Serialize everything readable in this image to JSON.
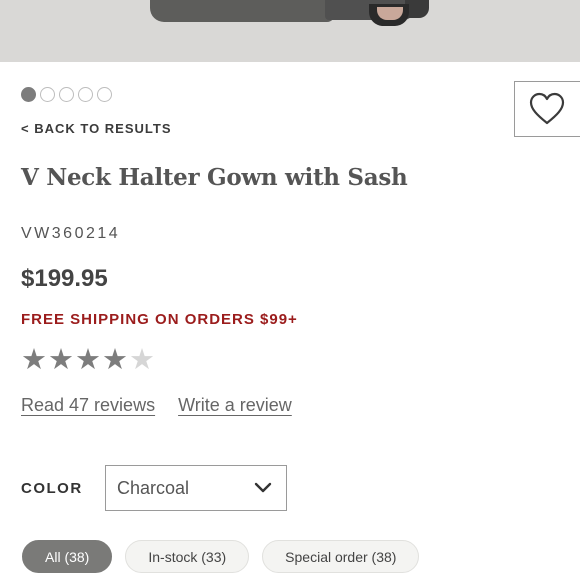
{
  "gallery": {
    "image": "product-photo-gown-bottom",
    "dot_count": 5,
    "active_dot": 0
  },
  "favorite": {
    "icon": "heart-icon"
  },
  "nav": {
    "back_label": "< BACK TO RESULTS"
  },
  "product": {
    "title": "V Neck Halter Gown with Sash",
    "sku": "VW360214",
    "price": "$199.95",
    "shipping_promo": "FREE SHIPPING ON ORDERS $99+",
    "rating": 4,
    "rating_max": 5
  },
  "reviews": {
    "read_label": "Read 47 reviews",
    "write_label": "Write a review"
  },
  "color": {
    "label": "COLOR",
    "selected": "Charcoal"
  },
  "filters": {
    "chips": [
      {
        "label": "All (38)",
        "active": true
      },
      {
        "label": "In-stock (33)",
        "active": false
      },
      {
        "label": "Special order (38)",
        "active": false
      }
    ]
  },
  "colors": {
    "promo_red": "#9b1c1c",
    "active_chip": "#7a7a78",
    "star_filled": "#7d7d7d",
    "star_empty": "#d6d6d6"
  }
}
